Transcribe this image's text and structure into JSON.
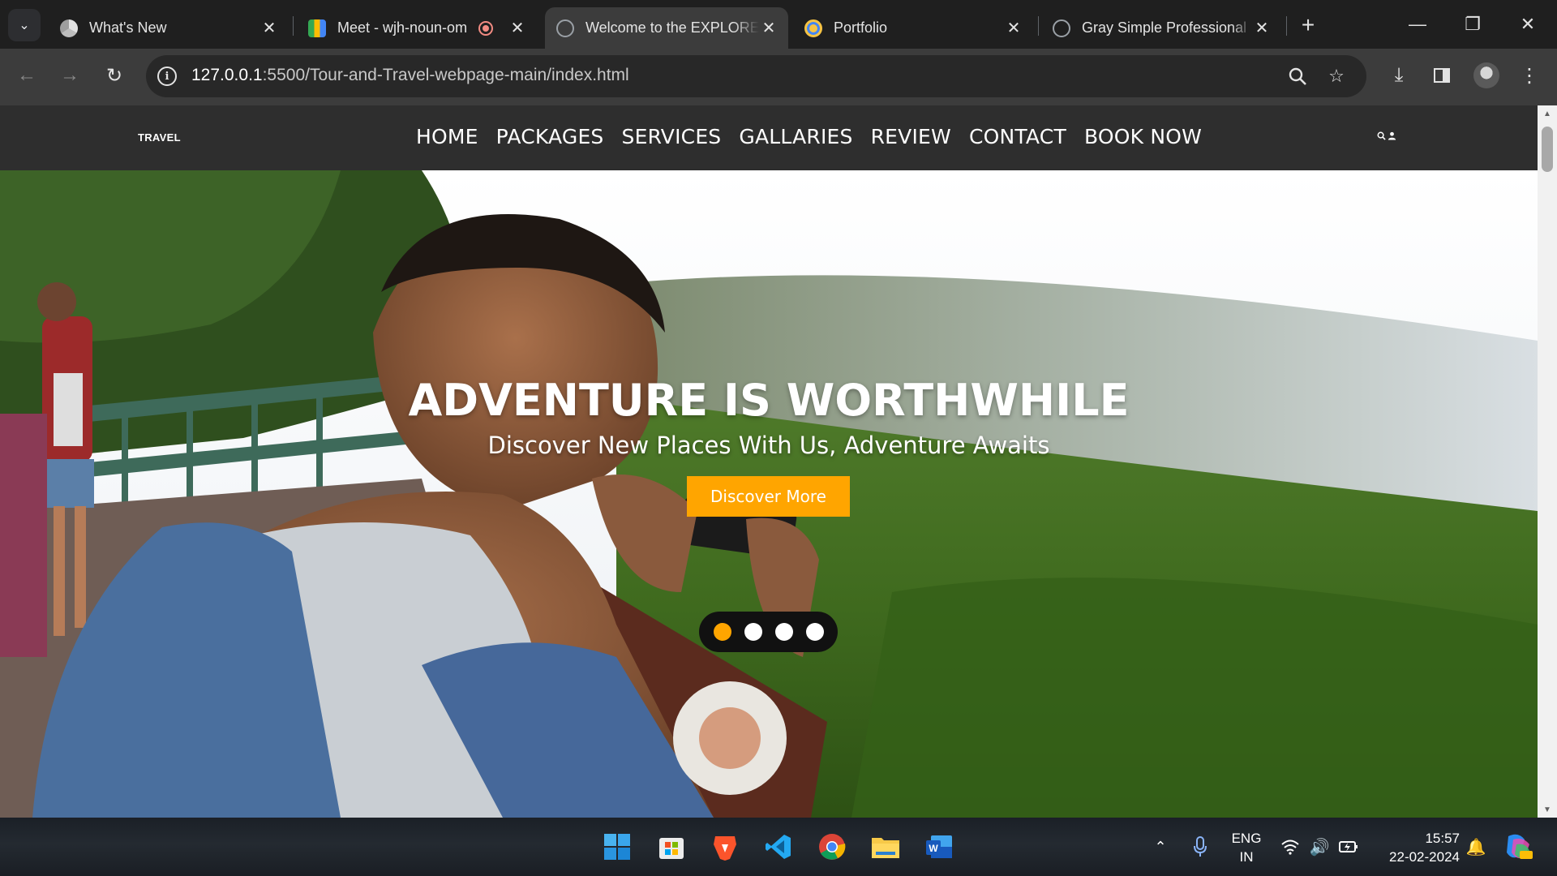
{
  "browser": {
    "tabs": [
      {
        "title": "What's New",
        "active": false
      },
      {
        "title": "Meet - wjh-noun-om",
        "active": false,
        "recording": true
      },
      {
        "title": "Welcome to the EXPLORE",
        "active": true
      },
      {
        "title": "Portfolio",
        "active": false
      },
      {
        "title": "Gray Simple Professional",
        "active": false
      }
    ],
    "url_host": "127.0.0.1",
    "url_rest": ":5500/Tour-and-Travel-webpage-main/index.html"
  },
  "site": {
    "logo": "TRAVEL",
    "nav": [
      "HOME",
      "PACKAGES",
      "SERVICES",
      "GALLARIES",
      "REVIEW",
      "CONTACT",
      "BOOK NOW"
    ],
    "hero_title": "ADVENTURE IS WORTHWHILE",
    "hero_subtitle": "Discover New Places With Us, Adventure Awaits",
    "hero_button": "Discover More",
    "slides": 4,
    "active_slide": 1,
    "accent": "#ffa500"
  },
  "taskbar": {
    "lang_line1": "ENG",
    "lang_line2": "IN",
    "time": "15:57",
    "date": "22-02-2024",
    "apps": [
      "start-icon",
      "microsoft-store-icon",
      "brave-icon",
      "vscode-icon",
      "chrome-icon",
      "file-explorer-icon",
      "word-icon"
    ]
  }
}
